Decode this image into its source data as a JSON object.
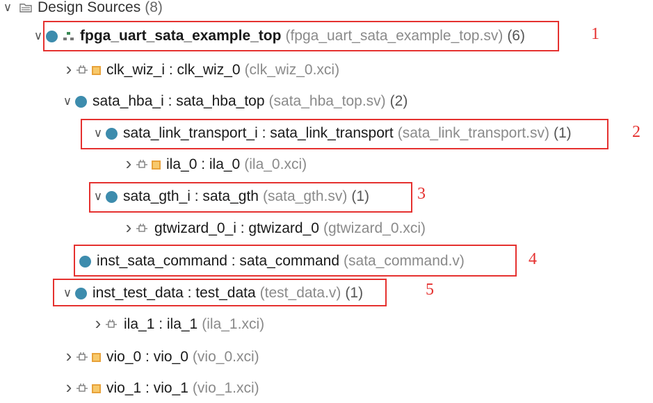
{
  "tree": {
    "root": {
      "label": "Design Sources",
      "count": "(8)"
    },
    "nodes": [
      {
        "name": "fpga_uart_sata_example_top",
        "file": "(fpga_uart_sata_example_top.sv)",
        "count": "(6)"
      },
      {
        "name": "clk_wiz_i : clk_wiz_0",
        "file": "(clk_wiz_0.xci)",
        "count": ""
      },
      {
        "name": "sata_hba_i : sata_hba_top",
        "file": "(sata_hba_top.sv)",
        "count": "(2)"
      },
      {
        "name": "sata_link_transport_i : sata_link_transport",
        "file": "(sata_link_transport.sv)",
        "count": "(1)"
      },
      {
        "name": "ila_0 : ila_0",
        "file": "(ila_0.xci)",
        "count": ""
      },
      {
        "name": "sata_gth_i : sata_gth",
        "file": "(sata_gth.sv)",
        "count": "(1)"
      },
      {
        "name": "gtwizard_0_i : gtwizard_0",
        "file": "(gtwizard_0.xci)",
        "count": ""
      },
      {
        "name": "inst_sata_command : sata_command",
        "file": "(sata_command.v)",
        "count": ""
      },
      {
        "name": "inst_test_data : test_data",
        "file": "(test_data.v)",
        "count": "(1)"
      },
      {
        "name": "ila_1 : ila_1",
        "file": "(ila_1.xci)",
        "count": ""
      },
      {
        "name": "vio_0 : vio_0",
        "file": "(vio_0.xci)",
        "count": ""
      },
      {
        "name": "vio_1 : vio_1",
        "file": "(vio_1.xci)",
        "count": ""
      }
    ]
  },
  "annotations": [
    "1",
    "2",
    "3",
    "4",
    "5"
  ],
  "colors": {
    "highlight": "#e5312f",
    "module_dot": "#3d8cad",
    "ip_square": "#e8a23a"
  }
}
